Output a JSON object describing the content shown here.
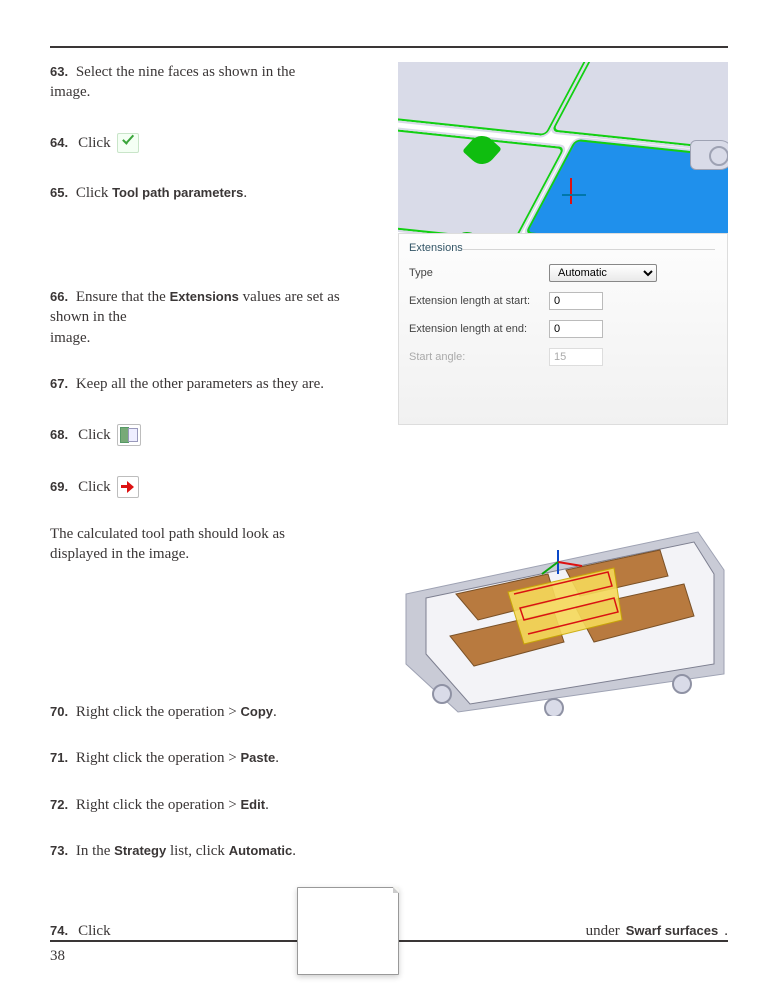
{
  "page_number": "38",
  "steps": {
    "s63": {
      "num": "63.",
      "text_a": "Select the nine faces as shown in the",
      "text_b": "image."
    },
    "s64": {
      "num": "64.",
      "text": "Click"
    },
    "s65": {
      "num": "65.",
      "text_a": "Click ",
      "bold": "Tool path parameters",
      "text_b": "."
    },
    "s66": {
      "num": "66.",
      "text_a": "Ensure that the ",
      "bold": "Extensions",
      "text_b": " values are set as shown in the",
      "text_c": "image."
    },
    "s67": {
      "num": "67.",
      "text": "Keep all the other parameters as they are."
    },
    "s68": {
      "num": "68.",
      "text": "Click"
    },
    "s69": {
      "num": "69.",
      "text": "Click"
    },
    "s69_note_a": "The calculated tool path should look as",
    "s69_note_b": "displayed in the image.",
    "s70": {
      "num": "70.",
      "text_a": "Right click the operation > ",
      "bold": "Copy",
      "text_b": "."
    },
    "s71": {
      "num": "71.",
      "text_a": "Right click the operation > ",
      "bold": "Paste",
      "text_b": "."
    },
    "s72": {
      "num": "72.",
      "text_a": "Right click the operation > ",
      "bold": "Edit",
      "text_b": "."
    },
    "s73": {
      "num": "73.",
      "text_a": "In the ",
      "bold_a": "Strategy",
      "text_b": " list, click ",
      "bold_b": "Automatic",
      "text_c": "."
    },
    "s74": {
      "num": "74.",
      "text_a": "Click ",
      "text_b": " under ",
      "bold": "Swarf surfaces",
      "text_c": "."
    }
  },
  "panel": {
    "group": "Extensions",
    "type_label": "Type",
    "type_value": "Automatic",
    "len_start_label": "Extension length at start:",
    "len_start_value": "0",
    "len_end_label": "Extension length at end:",
    "len_end_value": "0",
    "angle_label": "Start angle:",
    "angle_value": "15"
  }
}
